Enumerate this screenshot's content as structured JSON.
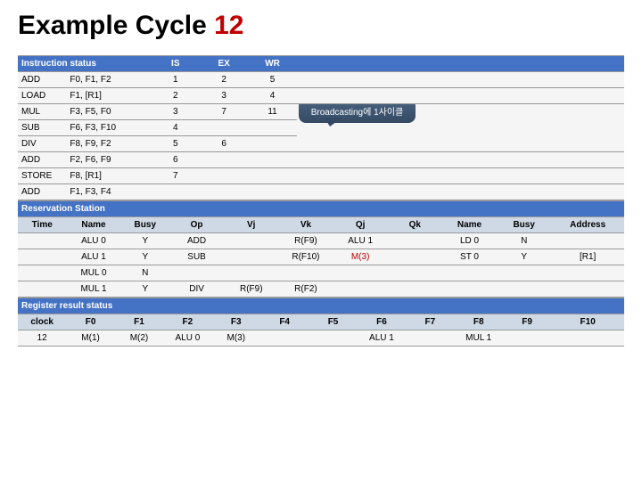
{
  "title_a": "Example Cycle ",
  "title_b": "12",
  "instr_header": "Instruction status",
  "cols": {
    "is": "IS",
    "ex": "EX",
    "wr": "WR"
  },
  "instr": [
    {
      "op": "ADD",
      "args": "F0, F1, F2",
      "is": "1",
      "ex": "2",
      "wr": "5"
    },
    {
      "op": "LOAD",
      "args": "F1, [R1]",
      "is": "2",
      "ex": "3",
      "wr": "4"
    },
    {
      "op": "MUL",
      "args": "F3, F5, F0",
      "is": "3",
      "ex": "7",
      "wr": "11"
    },
    {
      "op": "SUB",
      "args": "F6, F3, F10",
      "is": "4",
      "ex": "",
      "wr": ""
    },
    {
      "op": "DIV",
      "args": "F8, F9, F2",
      "is": "5",
      "ex": "6",
      "wr": ""
    },
    {
      "op": "ADD",
      "args": "F2, F6, F9",
      "is": "6",
      "ex": "",
      "wr": ""
    },
    {
      "op": "STORE",
      "args": "F8, [R1]",
      "is": "7",
      "ex": "",
      "wr": ""
    },
    {
      "op": "ADD",
      "args": "F1, F3, F4",
      "is": "",
      "ex": "",
      "wr": ""
    }
  ],
  "callout": "Broadcasting에 1사이클",
  "rs_header": "Reservation Station",
  "rs_cols": {
    "time": "Time",
    "name": "Name",
    "busy": "Busy",
    "op": "Op",
    "vj": "Vj",
    "vk": "Vk",
    "qj": "Qj",
    "qk": "Qk",
    "name2": "Name",
    "busy2": "Busy",
    "addr": "Address"
  },
  "rs": [
    {
      "name": "ALU 0",
      "busy": "Y",
      "op": "ADD",
      "vj": "",
      "vk": "R(F9)",
      "qj": "ALU 1",
      "qk": "",
      "name2": "LD 0",
      "busy2": "N",
      "addr": ""
    },
    {
      "name": "ALU 1",
      "busy": "Y",
      "op": "SUB",
      "vj": "",
      "vk": "R(F10)",
      "qj": "M(3)",
      "qk": "",
      "name2": "ST 0",
      "busy2": "Y",
      "addr": "[R1]"
    },
    {
      "name": "MUL 0",
      "busy": "N",
      "op": "",
      "vj": "",
      "vk": "",
      "qj": "",
      "qk": "",
      "name2": "",
      "busy2": "",
      "addr": ""
    },
    {
      "name": "MUL 1",
      "busy": "Y",
      "op": "DIV",
      "vj": "R(F9)",
      "vk": "R(F2)",
      "qj": "",
      "qk": "",
      "name2": "",
      "busy2": "",
      "addr": ""
    }
  ],
  "reg_header": "Register result status",
  "reg_cols": {
    "clock": "clock",
    "f0": "F0",
    "f1": "F1",
    "f2": "F2",
    "f3": "F3",
    "f4": "F4",
    "f5": "F5",
    "f6": "F6",
    "f7": "F7",
    "f8": "F8",
    "f9": "F9",
    "f10": "F10"
  },
  "reg_row": {
    "clock": "12",
    "f0": "M(1)",
    "f1": "M(2)",
    "f2": "ALU 0",
    "f3": "M(3)",
    "f4": "",
    "f5": "",
    "f6": "ALU 1",
    "f7": "",
    "f8": "MUL 1",
    "f9": "",
    "f10": ""
  },
  "qj_red": "M(3)"
}
